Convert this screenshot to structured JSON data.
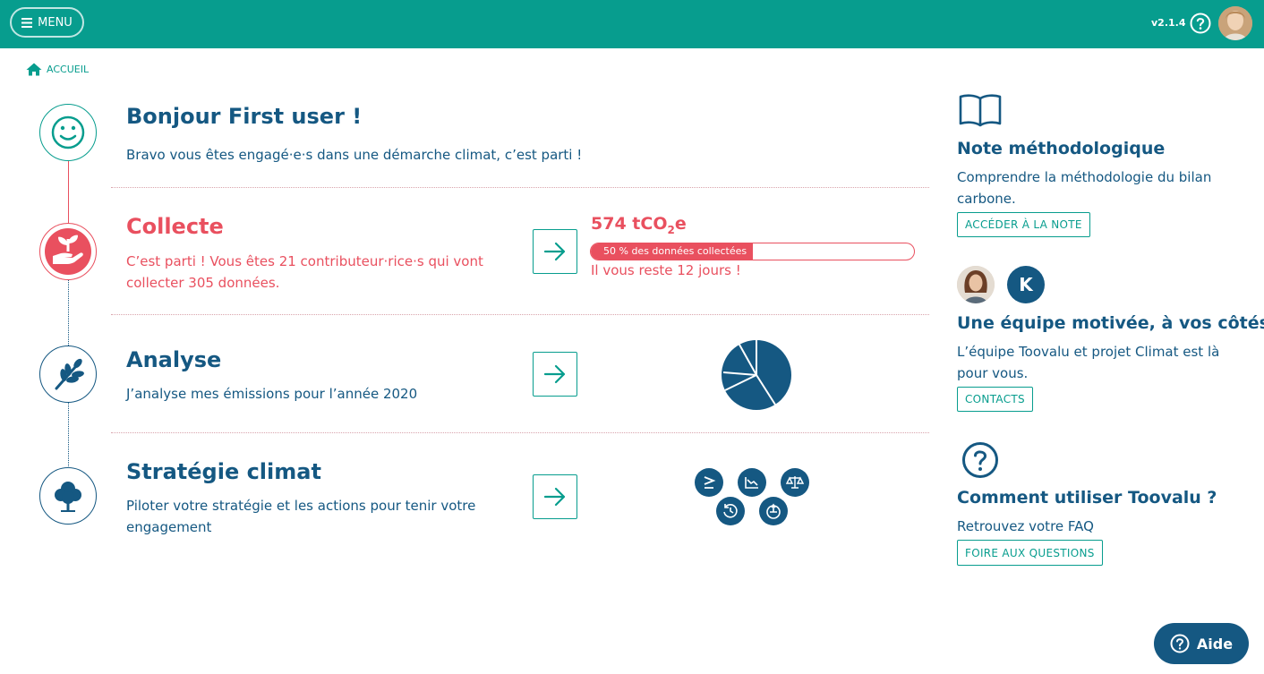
{
  "header": {
    "menu_label": "MENU",
    "version": "v2.1.4",
    "help_icon": "question-circle-icon",
    "avatar": "user-avatar"
  },
  "breadcrumb": {
    "label": "ACCUEIL",
    "icon": "home-icon"
  },
  "welcome": {
    "title": "Bonjour First user !",
    "text": "Bravo vous êtes engagé·e·s dans une démarche climat, c’est parti !",
    "icon": "smile-icon"
  },
  "collecte": {
    "title": "Collecte",
    "text": "C’est parti ! Vous êtes 21 contributeur·rice·s qui vont collecter 305 données.",
    "icon": "hand-plant-icon",
    "emissions_value": "574",
    "emissions_unit_prefix": "tCO",
    "emissions_unit_sub": "2",
    "emissions_unit_suffix": "e",
    "progress_label": "50 % des données collectées",
    "progress_value": 0.5,
    "remaining": "Il vous reste 12 jours !",
    "colors": {
      "accent": "#e9505f"
    }
  },
  "analyse": {
    "title": "Analyse",
    "text": "J’analyse mes émissions pour l’année 2020",
    "icon": "wheat-icon"
  },
  "strategie": {
    "title": "Stratégie climat",
    "text": "Piloter votre stratégie et les actions pour tenir votre engagement",
    "icon": "tree-icon",
    "mini_icons": [
      "greater-equal-icon",
      "chart-down-icon",
      "balance-scale-icon",
      "history-icon",
      "target-icon"
    ]
  },
  "sidebar": {
    "note": {
      "title": "Note méthodologique",
      "text": "Comprendre la méthodologie du bilan carbone.",
      "button": "ACCÉDER À LA NOTE",
      "icon": "book-icon"
    },
    "team": {
      "title": "Une équipe motivée, à vos côtés !",
      "text": "L’équipe Toovalu et projet Climat est là pour vous.",
      "button": "CONTACTS",
      "avatar_letter": "K"
    },
    "faq": {
      "title": "Comment utiliser Toovalu ?",
      "text": "Retrouvez votre FAQ",
      "button": "FOIRE AUX QUESTIONS",
      "icon": "question-circle-icon"
    }
  },
  "aide_button": {
    "label": "Aide",
    "icon": "question-circle-icon"
  },
  "colors": {
    "primary": "#079d8e",
    "navy": "#155882",
    "red": "#e9505f"
  }
}
